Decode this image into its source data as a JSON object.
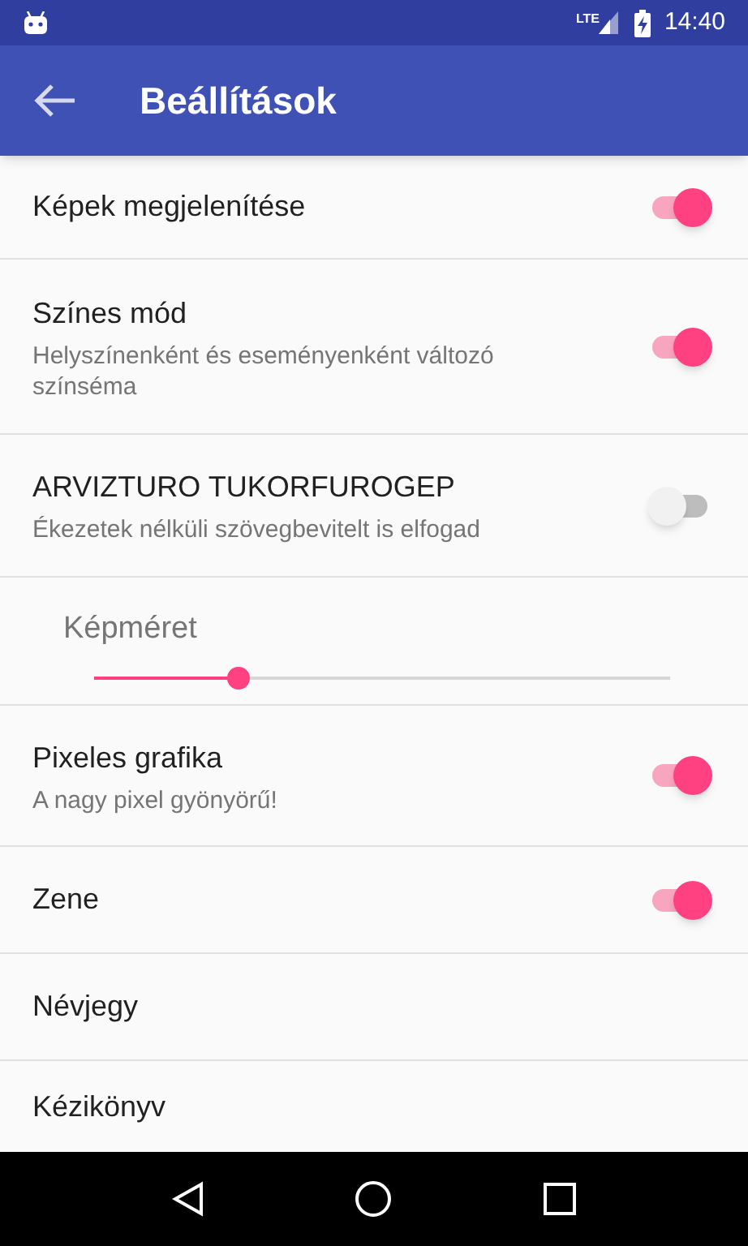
{
  "status_bar": {
    "network": "LTE",
    "time": "14:40"
  },
  "toolbar": {
    "title": "Beállítások"
  },
  "settings": [
    {
      "kind": "switch",
      "title": "Képek megjelenítése",
      "on": true
    },
    {
      "kind": "switch",
      "title": "Színes mód",
      "summary": "Helyszínenként és eseményenként változó színséma",
      "on": true
    },
    {
      "kind": "switch",
      "title": "ARVIZTURO TUKORFUROGEP",
      "summary": "Ékezetek nélküli szövegbevitelt is elfogad",
      "on": false
    },
    {
      "kind": "slider",
      "title": "Képméret",
      "level": 0.25
    },
    {
      "kind": "switch",
      "title": "Pixeles grafika",
      "summary": "A nagy pixel gyönyörű!",
      "on": true
    },
    {
      "kind": "switch",
      "title": "Zene",
      "on": true
    },
    {
      "kind": "plain",
      "title": "Névjegy"
    },
    {
      "kind": "plain",
      "title": "Kézikönyv"
    }
  ]
}
